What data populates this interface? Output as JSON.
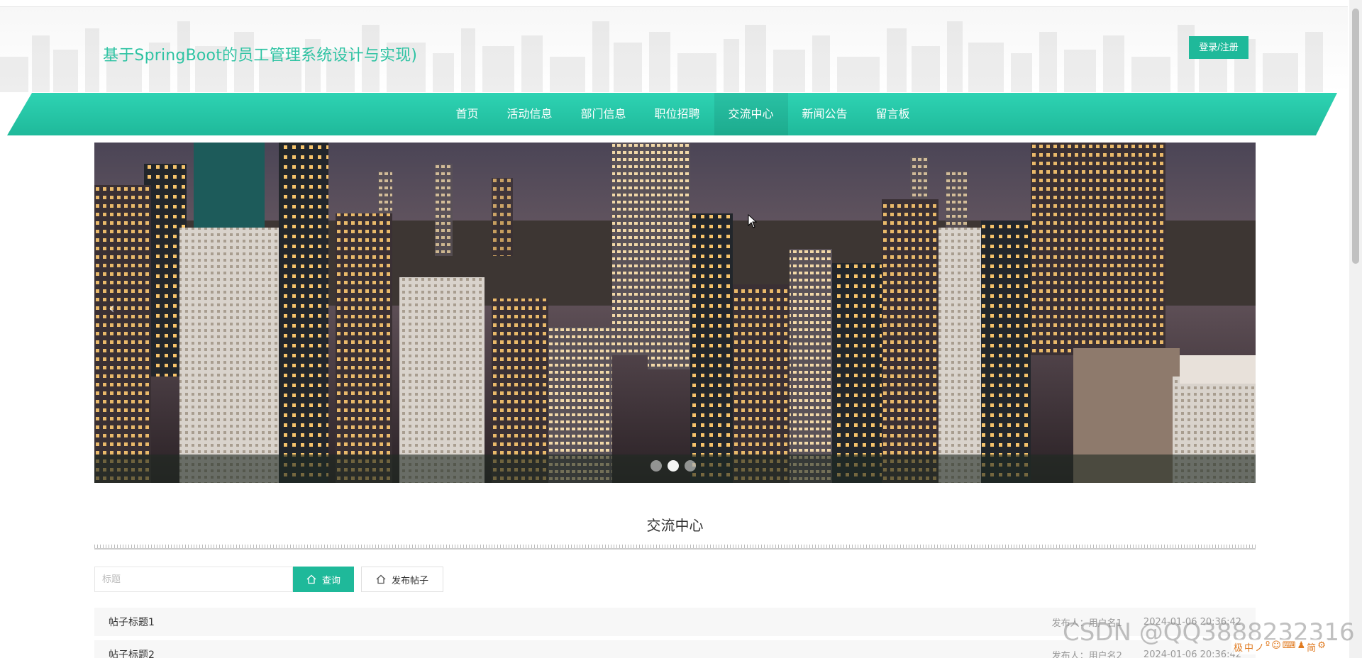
{
  "header": {
    "title": "基于SpringBoot的员工管理系统设计与实现)",
    "login_label": "登录/注册"
  },
  "nav": {
    "items": [
      {
        "label": "首页"
      },
      {
        "label": "活动信息"
      },
      {
        "label": "部门信息"
      },
      {
        "label": "职位招聘"
      },
      {
        "label": "交流中心",
        "active": true
      },
      {
        "label": "新闻公告"
      },
      {
        "label": "留言板"
      }
    ],
    "color_start": "#1fb99a",
    "color_end": "#2ed3b3"
  },
  "banner": {
    "prev_icon": "‹",
    "slide_count": 3,
    "active_slide": 1
  },
  "section": {
    "title": "交流中心"
  },
  "search": {
    "placeholder": "标题",
    "query_label": "查询",
    "post_label": "发布帖子"
  },
  "posts": [
    {
      "title": "帖子标题1",
      "author": "发布人：用户名1",
      "date": "2024-01-06 20:36:42"
    },
    {
      "title": "帖子标题2",
      "author": "发布人：用户名2",
      "date": "2024-01-06 20:36:42"
    }
  ],
  "overlay": {
    "watermark": "CSDN @QQ3888232316",
    "ime_items": [
      "极",
      "中",
      "ノ",
      "º",
      "☺",
      "⌨",
      "♟",
      "简",
      "⚙"
    ]
  },
  "colors": {
    "accent": "#1fb99a",
    "title": "#2fc3a3"
  }
}
